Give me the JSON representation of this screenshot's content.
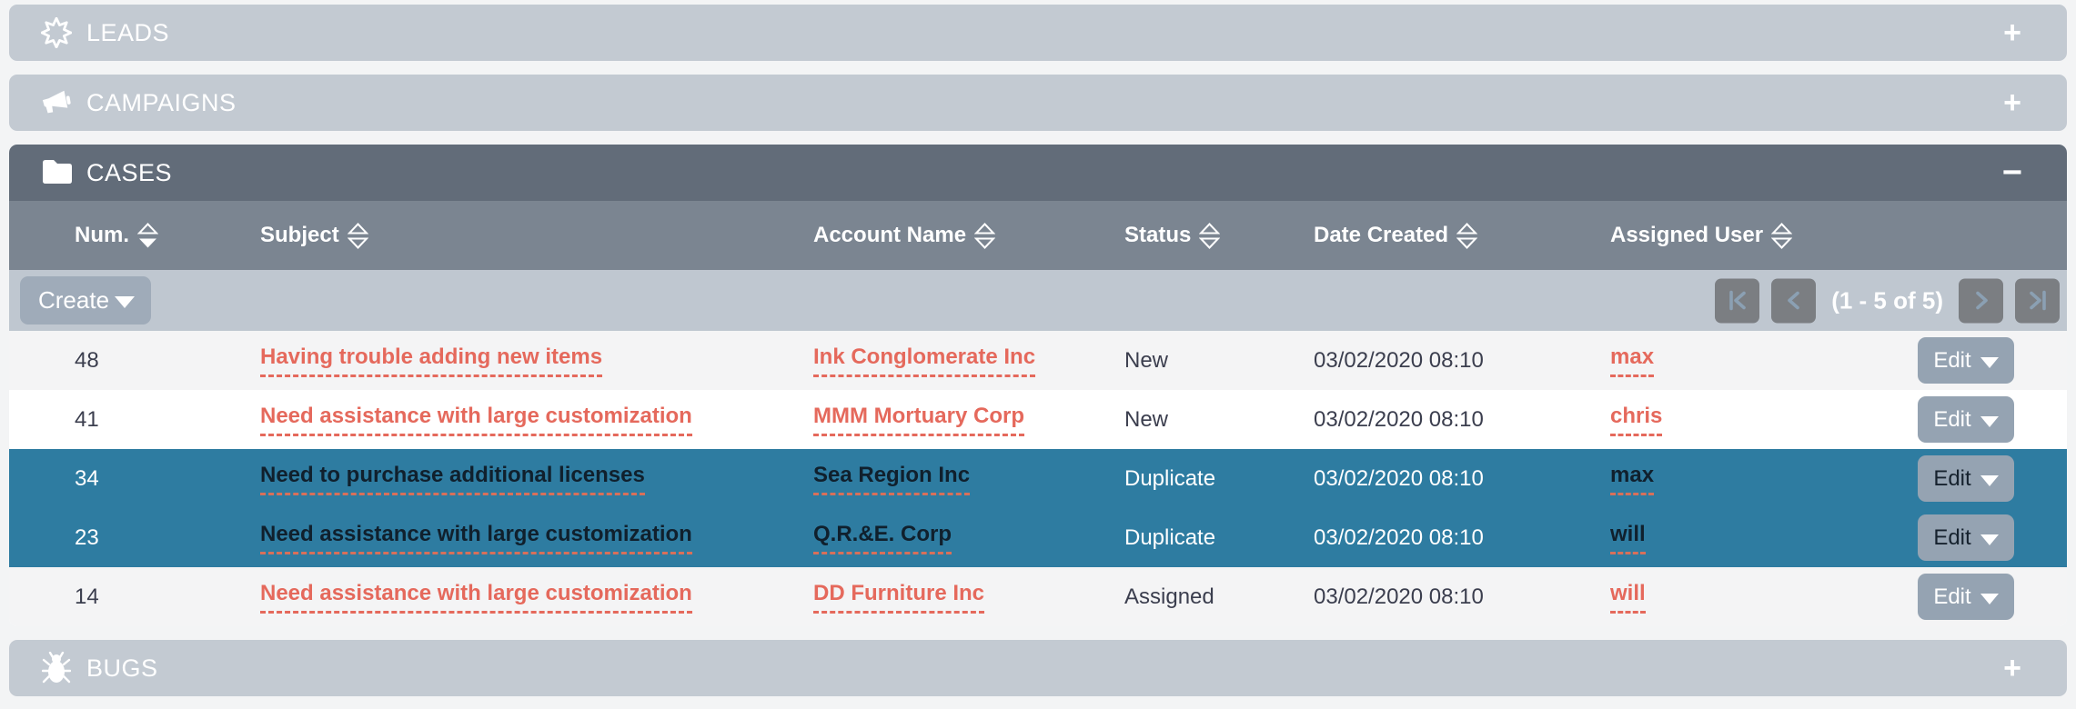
{
  "colors": {
    "accent_link": "#e5695c",
    "selected_row": "#2e7ca1",
    "panel_collapsed": "#c3cad2",
    "cases_header": "#626c79",
    "column_header": "#7b8591",
    "toolbar": "#bfc7d0"
  },
  "icons": {
    "leads": "star-burst-icon",
    "campaigns": "megaphone-icon",
    "cases": "folder-icon",
    "bugs": "bug-icon",
    "expand": "plus-icon",
    "collapse": "minus-icon"
  },
  "panels": {
    "leads": {
      "label": "LEADS",
      "toggle": "+"
    },
    "campaigns": {
      "label": "CAMPAIGNS",
      "toggle": "+"
    },
    "cases": {
      "label": "CASES",
      "toggle": "−"
    },
    "bugs": {
      "label": "BUGS",
      "toggle": "+"
    }
  },
  "cases_table": {
    "columns": [
      {
        "label": "Num.",
        "sort": "desc"
      },
      {
        "label": "Subject",
        "sort": "none"
      },
      {
        "label": "Account Name",
        "sort": "none"
      },
      {
        "label": "Status",
        "sort": "none"
      },
      {
        "label": "Date Created",
        "sort": "none"
      },
      {
        "label": "Assigned User",
        "sort": "none"
      }
    ],
    "create_label": "Create",
    "edit_label": "Edit",
    "pagination": {
      "count_label": "(1 - 5 of 5)"
    },
    "rows": [
      {
        "num": "48",
        "subject": "Having trouble adding new items",
        "account": "Ink Conglomerate Inc",
        "status": "New",
        "date": "03/02/2020 08:10",
        "user": "max",
        "selected": false
      },
      {
        "num": "41",
        "subject": "Need assistance with large customization",
        "account": "MMM Mortuary Corp",
        "status": "New",
        "date": "03/02/2020 08:10",
        "user": "chris",
        "selected": false
      },
      {
        "num": "34",
        "subject": "Need to purchase additional licenses",
        "account": "Sea Region Inc",
        "status": "Duplicate",
        "date": "03/02/2020 08:10",
        "user": "max",
        "selected": true
      },
      {
        "num": "23",
        "subject": "Need assistance with large customization",
        "account": "Q.R.&E. Corp",
        "status": "Duplicate",
        "date": "03/02/2020 08:10",
        "user": "will",
        "selected": true
      },
      {
        "num": "14",
        "subject": "Need assistance with large customization",
        "account": "DD Furniture Inc",
        "status": "Assigned",
        "date": "03/02/2020 08:10",
        "user": "will",
        "selected": false
      }
    ]
  }
}
